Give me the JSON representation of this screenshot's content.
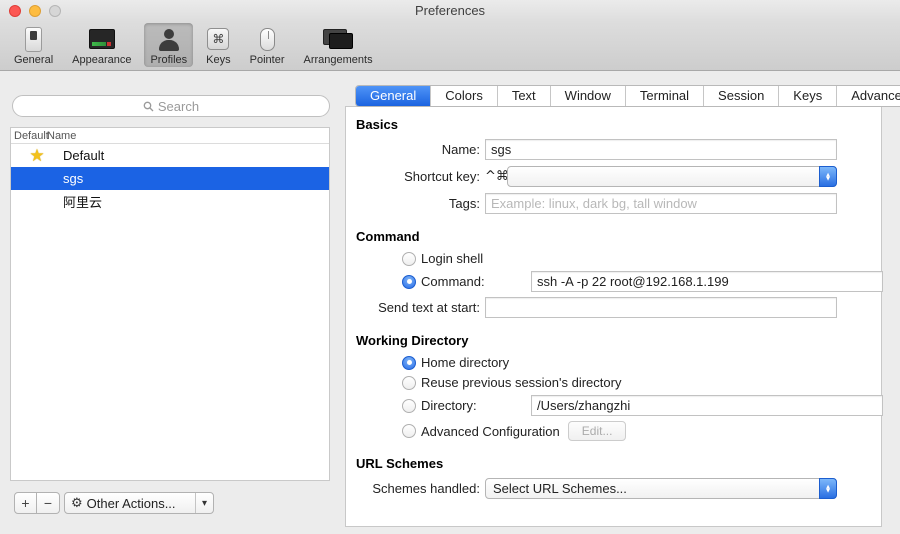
{
  "window": {
    "title": "Preferences"
  },
  "toolbar": {
    "items": [
      {
        "label": "General"
      },
      {
        "label": "Appearance"
      },
      {
        "label": "Profiles"
      },
      {
        "label": "Keys"
      },
      {
        "label": "Pointer"
      },
      {
        "label": "Arrangements"
      }
    ]
  },
  "sidebar": {
    "search_placeholder": "Search",
    "columns": {
      "default": "Default",
      "name": "Name"
    },
    "profiles": [
      {
        "name": "Default"
      },
      {
        "name": "sgs"
      },
      {
        "name": "阿里云"
      }
    ],
    "add_label": "+",
    "remove_label": "−",
    "other_actions_label": "Other Actions..."
  },
  "tabs": [
    "General",
    "Colors",
    "Text",
    "Window",
    "Terminal",
    "Session",
    "Keys",
    "Advanced"
  ],
  "general_tab": {
    "basics": {
      "heading": "Basics",
      "name_label": "Name:",
      "name_value": "sgs",
      "shortcut_label": "Shortcut key:",
      "shortcut_prefix": "^⌘",
      "tags_label": "Tags:",
      "tags_placeholder": "Example: linux, dark bg, tall window"
    },
    "command": {
      "heading": "Command",
      "login_shell_label": "Login shell",
      "command_label": "Command:",
      "command_value": "ssh -A -p 22 root@192.168.1.199",
      "send_text_label": "Send text at start:"
    },
    "working_directory": {
      "heading": "Working Directory",
      "home_label": "Home directory",
      "reuse_label": "Reuse previous session's directory",
      "directory_label": "Directory:",
      "directory_value": "/Users/zhangzhi",
      "advanced_label": "Advanced Configuration",
      "edit_button": "Edit..."
    },
    "url_schemes": {
      "heading": "URL Schemes",
      "schemes_label": "Schemes handled:",
      "schemes_value": "Select URL Schemes..."
    }
  },
  "icons": {
    "command_glyph": "⌘",
    "gear": "⚙",
    "chevron_down": "▾",
    "star": "★",
    "arrow_up": "▲",
    "arrow_down": "▼"
  },
  "colors": {
    "accent": "#1b63e4",
    "selected_tab": "#2a6fe2",
    "selection_blue": "#1b63e4"
  }
}
